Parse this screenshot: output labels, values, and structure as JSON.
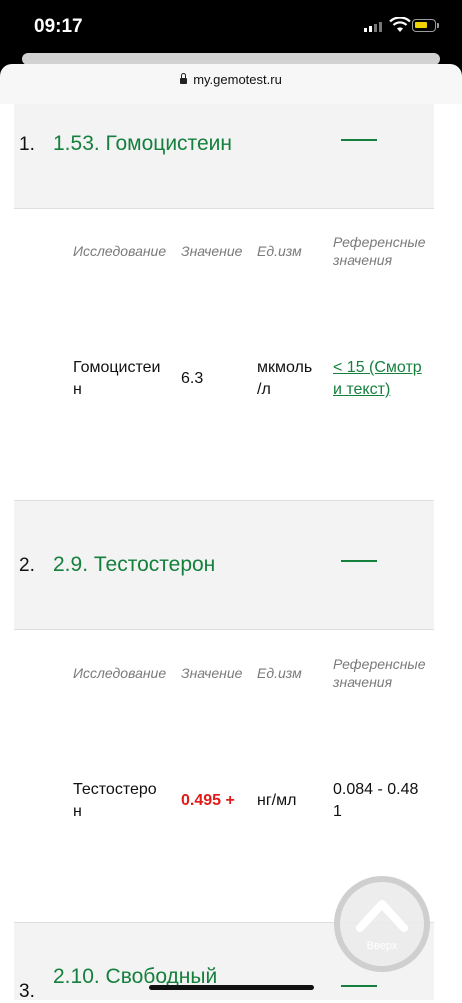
{
  "status": {
    "time": "09:17"
  },
  "browser": {
    "url": "my.gemotest.ru"
  },
  "columns": {
    "test": "Исследование",
    "value": "Значение",
    "unit": "Ед.изм",
    "ref_line1": "Референсные",
    "ref_line2": "значения"
  },
  "sections": [
    {
      "number": "1.",
      "title": "1.53. Гомоцистеин",
      "result": {
        "name_line1": "Гомоцистеи",
        "name_line2": "н",
        "value": "6.3",
        "unit_line1": "мкмоль",
        "unit_line2": "/л",
        "ref_line1": "< 15 (Смотр",
        "ref_line2": "и текст)"
      }
    },
    {
      "number": "2.",
      "title": "2.9. Тестостерон",
      "result": {
        "name_line1": "Тестостеро",
        "name_line2": "н",
        "value": "0.495 +",
        "unit": "нг/мл",
        "ref_line1": "0.084 - 0.48",
        "ref_line2": "1"
      }
    },
    {
      "number": "3.",
      "title": "2.10. Свободный"
    }
  ],
  "scroll_up": {
    "label": "Вверх"
  },
  "colors": {
    "accent": "#15803d",
    "flag": "#e01b1b"
  }
}
